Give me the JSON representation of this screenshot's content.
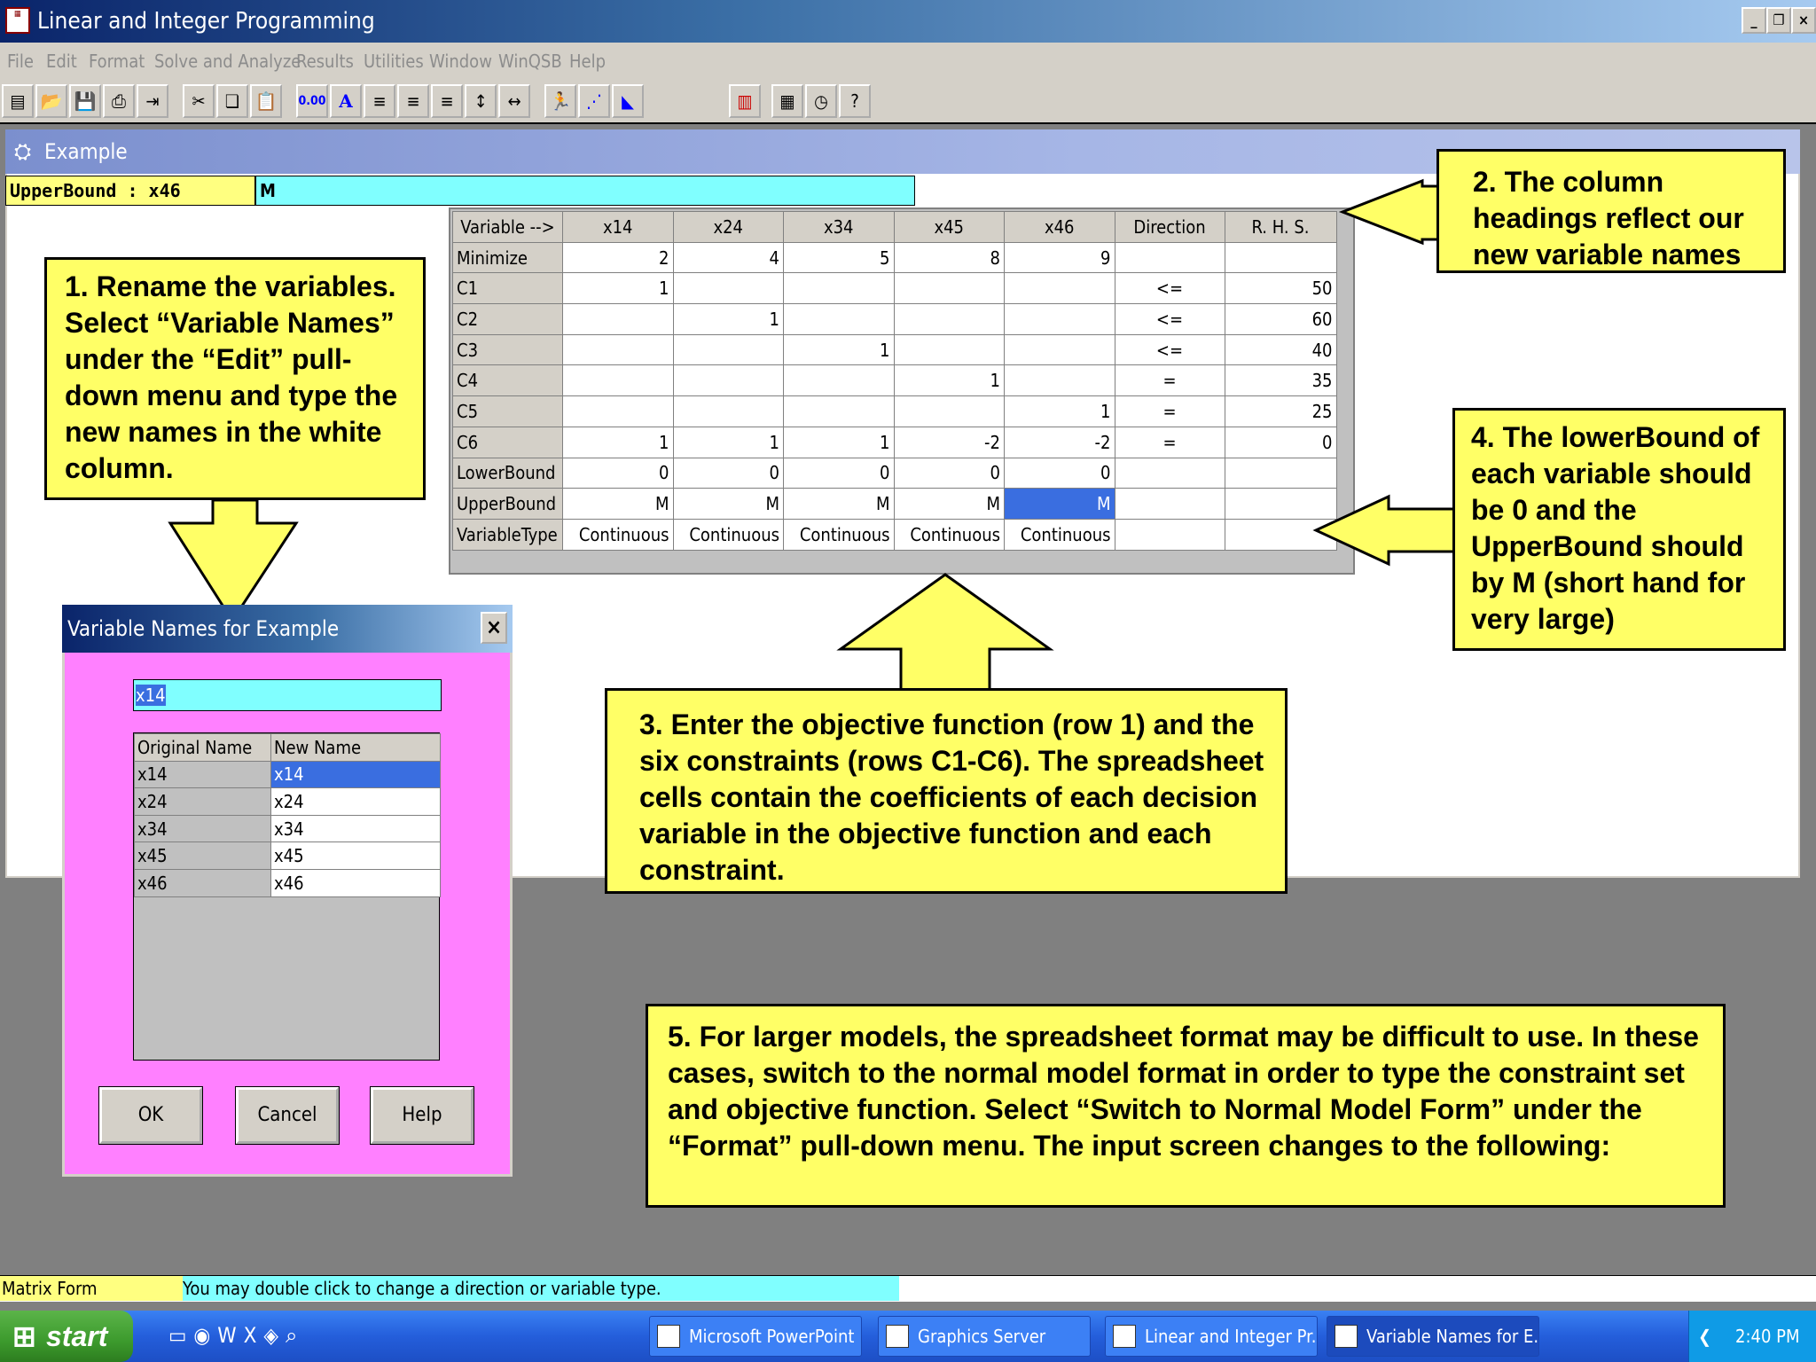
{
  "app": {
    "title": "Linear and Integer Programming",
    "icon": "winqsb-icon"
  },
  "window_controls": [
    "minimize-icon",
    "restore-icon",
    "close-icon"
  ],
  "menu": [
    "File",
    "Edit",
    "Format",
    "Solve and Analyze",
    "Results",
    "Utilities",
    "Window",
    "WinQSB",
    "Help"
  ],
  "toolbar": {
    "decimal_label": "0.00",
    "font_label": "A"
  },
  "document": {
    "title": "Example",
    "cell_ref": "UpperBound : x46",
    "cell_value": "M"
  },
  "sheet": {
    "headers": [
      "Variable -->",
      "x14",
      "x24",
      "x34",
      "x45",
      "x46",
      "Direction",
      "R. H. S."
    ],
    "rows": [
      [
        "Minimize",
        "2",
        "4",
        "5",
        "8",
        "9",
        "",
        ""
      ],
      [
        "C1",
        "1",
        "",
        "",
        "",
        "",
        "<=",
        "50"
      ],
      [
        "C2",
        "",
        "1",
        "",
        "",
        "",
        "<=",
        "60"
      ],
      [
        "C3",
        "",
        "",
        "1",
        "",
        "",
        "<=",
        "40"
      ],
      [
        "C4",
        "",
        "",
        "",
        "1",
        "",
        "=",
        "35"
      ],
      [
        "C5",
        "",
        "",
        "",
        "",
        "1",
        "=",
        "25"
      ],
      [
        "C6",
        "1",
        "1",
        "1",
        "-2",
        "-2",
        "=",
        "0"
      ],
      [
        "LowerBound",
        "0",
        "0",
        "0",
        "0",
        "0",
        "",
        ""
      ],
      [
        "UpperBound",
        "M",
        "M",
        "M",
        "M",
        "M",
        "",
        ""
      ],
      [
        "VariableType",
        "Continuous",
        "Continuous",
        "Continuous",
        "Continuous",
        "Continuous",
        "",
        ""
      ]
    ]
  },
  "notes": {
    "n1": "1. Rename the variables. Select “Variable Names” under the “Edit” pull-down menu and type the new names in the white column.",
    "n2": "2. The column headings reflect our new variable names",
    "n3": "3. Enter the objective function (row 1) and the six constraints (rows C1-C6).  The spreadsheet cells contain the coefficients of each decision variable in the objective function and each constraint.",
    "n4": "4. The lowerBound of each variable should be 0 and the UpperBound should by M (short hand for very large)",
    "n5": "5. For larger models, the spreadsheet format may be difficult to use.  In these cases, switch to the normal model format in order to type the constraint set and objective function.  Select “Switch to Normal Model Form” under the “Format” pull-down menu.  The input screen changes to the following:"
  },
  "dialog": {
    "title": "Variable Names for Example",
    "input_value": "x14",
    "columns": [
      "Original Name",
      "New Name"
    ],
    "rows": [
      [
        "x14",
        "x14"
      ],
      [
        "x24",
        "x24"
      ],
      [
        "x34",
        "x34"
      ],
      [
        "x45",
        "x45"
      ],
      [
        "x46",
        "x46"
      ]
    ],
    "ok": "OK",
    "cancel": "Cancel",
    "help": "Help"
  },
  "status": {
    "mode": "Matrix Form",
    "hint": "You may double click to change a direction or variable type."
  },
  "taskbar": {
    "start": "start",
    "tasks": [
      "Microsoft PowerPoint ...",
      "Graphics Server",
      "Linear and Integer Pr...",
      "Variable Names for E..."
    ],
    "clock": "2:40 PM"
  },
  "colors": {
    "note_fill": "#ffff66",
    "dialog_bg": "#ff80ff",
    "selection": "#3a6ee0",
    "cell_value_bg": "#80ffff",
    "cell_ref_bg": "#ffff80"
  }
}
